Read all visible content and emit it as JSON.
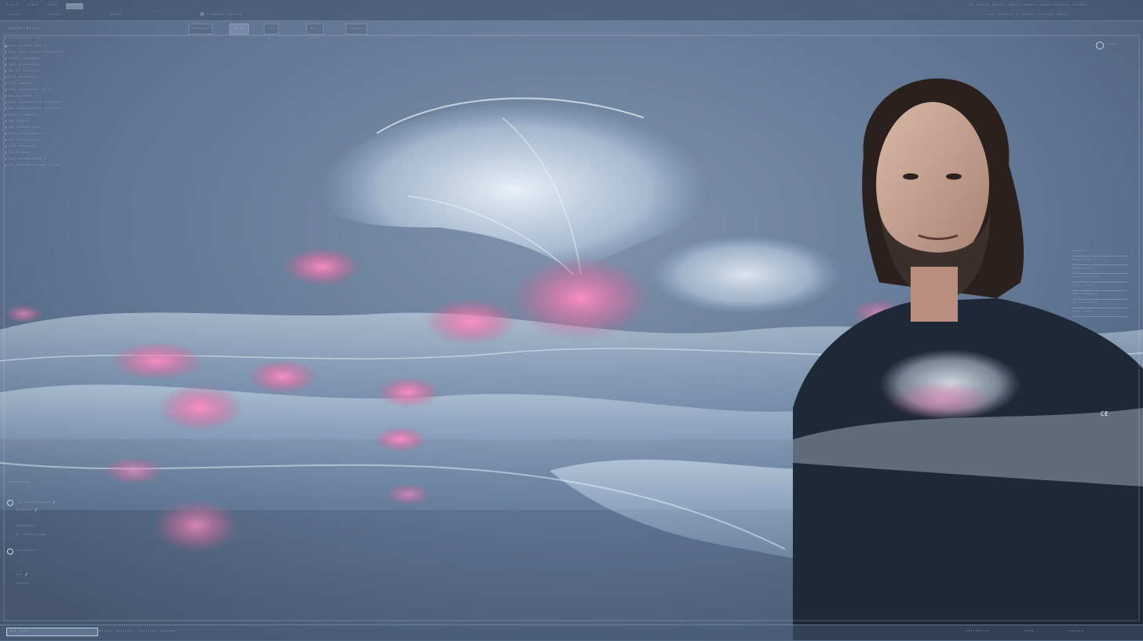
{
  "colors": {
    "background": "#5e7591",
    "glow_white": "#eaf6ff",
    "glow_pink": "#ff7fb6",
    "shirt": "#1f2836"
  },
  "menubar": {
    "items": [
      "·····",
      "·····",
      "·····",
      "······",
      "·····",
      "······",
      "·····"
    ],
    "right_text": "·· ······ ······ ····· ······ ····· ······· ······"
  },
  "toolbar": {
    "left_label": "Ⓞ ······· ······",
    "right_label": "··· ······· · ····· ······· ····"
  },
  "panel_title": "····· ·····",
  "tabs": [
    "·······",
    "·····",
    "··· ◦",
    "·· ····",
    "······"
  ],
  "tree": [
    "·········· ···",
    "··· ······ ··· ·",
    "··· ········· ·········",
    "····· ·······",
    "··· ·········",
    "·· ·· ·······",
    "··· ········· ·",
    "··· ······",
    "··· ········· ·· ·",
    "·· ······· ·",
    "··· ·········· ·······",
    "·· ··········· ·······",
    "··· ········",
    "·· ······",
    "·· ··········",
    "··· ··········",
    "·· ··········",
    "··· ········",
    "·· ······",
    "··· ·········· ·",
    "·· ············· ····"
  ],
  "right_panel": {
    "header": "····· ·",
    "rows": [
      "········· ·",
      "··· ····· ·",
      "·· ······ ··",
      "···· ·····",
      "··· ······ ·",
      "·· ······ ··",
      "···· ·····"
    ]
  },
  "overlay_right_top": "◦ ···",
  "logo_mark": "CE",
  "bottom_left": {
    "items": [
      "·········",
      "·· ··········· /",
      "······· /",
      "········",
      "·· ··········",
      "·········",
      "··· /",
      "······"
    ]
  },
  "statusbar": {
    "input_value": "··· ·····",
    "items": [
      "······ ········",
      "········ ·······"
    ],
    "right_items": [
      "··· ··· ··",
      "····",
      "······"
    ]
  }
}
